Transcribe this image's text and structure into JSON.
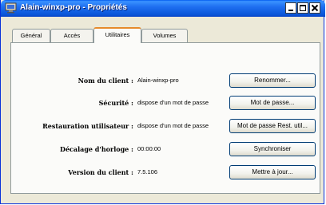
{
  "window": {
    "title": "Alain-winxp-pro - Propriétés",
    "icon": "server-properties-icon"
  },
  "tabs": [
    {
      "label": "Général"
    },
    {
      "label": "Accès"
    },
    {
      "label": "Utilitaires"
    },
    {
      "label": "Volumes"
    }
  ],
  "active_tab": "Utilitaires",
  "rows": [
    {
      "label": "Nom du client :",
      "value": "Alain-winxp-pro",
      "button": "Renommer..."
    },
    {
      "label": "Sécurité :",
      "value": "dispose d'un mot de passe",
      "button": "Mot de passe..."
    },
    {
      "label": "Restauration utilisateur :",
      "value": "dispose d'un mot de passe",
      "button": "Mot de passe Rest. util..."
    },
    {
      "label": "Décalage d'horloge :",
      "value": "00:00:00",
      "button": "Synchroniser"
    },
    {
      "label": "Version du client :",
      "value": "7.5.106",
      "button": "Mettre à jour..."
    }
  ],
  "colors": {
    "titlebar": "#0a55d8",
    "window_bg": "#ece9d8",
    "active_tab_accent": "#e68b2c"
  }
}
